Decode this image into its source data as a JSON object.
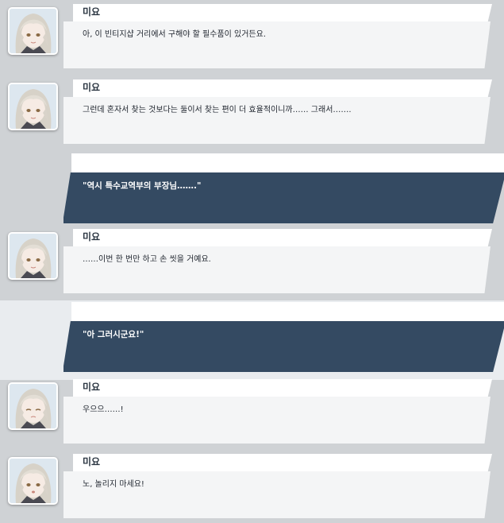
{
  "conversation": {
    "messages": [
      {
        "kind": "npc",
        "name": "미요",
        "text": "아, 이 빈티지샵 거리에서 구해야 할 필수품이 있거든요."
      },
      {
        "kind": "npc",
        "name": "미요",
        "text": "그런데 혼자서 찾는 것보다는 둘이서 찾는 편이 더 효율적이니까…… 그래서……."
      },
      {
        "kind": "reply",
        "text": "\"역시 특수교역부의 부장님…….\""
      },
      {
        "kind": "npc",
        "name": "미요",
        "text": "……이번 한 번만 하고 손 씻을 거예요."
      },
      {
        "kind": "reply",
        "text": "\"아 그러시군요!\""
      },
      {
        "kind": "npc",
        "name": "미요",
        "text": "우으으……!"
      },
      {
        "kind": "npc",
        "name": "미요",
        "text": "노, 놀리지 마세요!"
      }
    ]
  },
  "colors": {
    "reply_box": "#344a62",
    "npc_bubble": "#f4f5f6",
    "background": "#d8dadc"
  },
  "icons": {
    "avatar": "miyo-portrait"
  }
}
